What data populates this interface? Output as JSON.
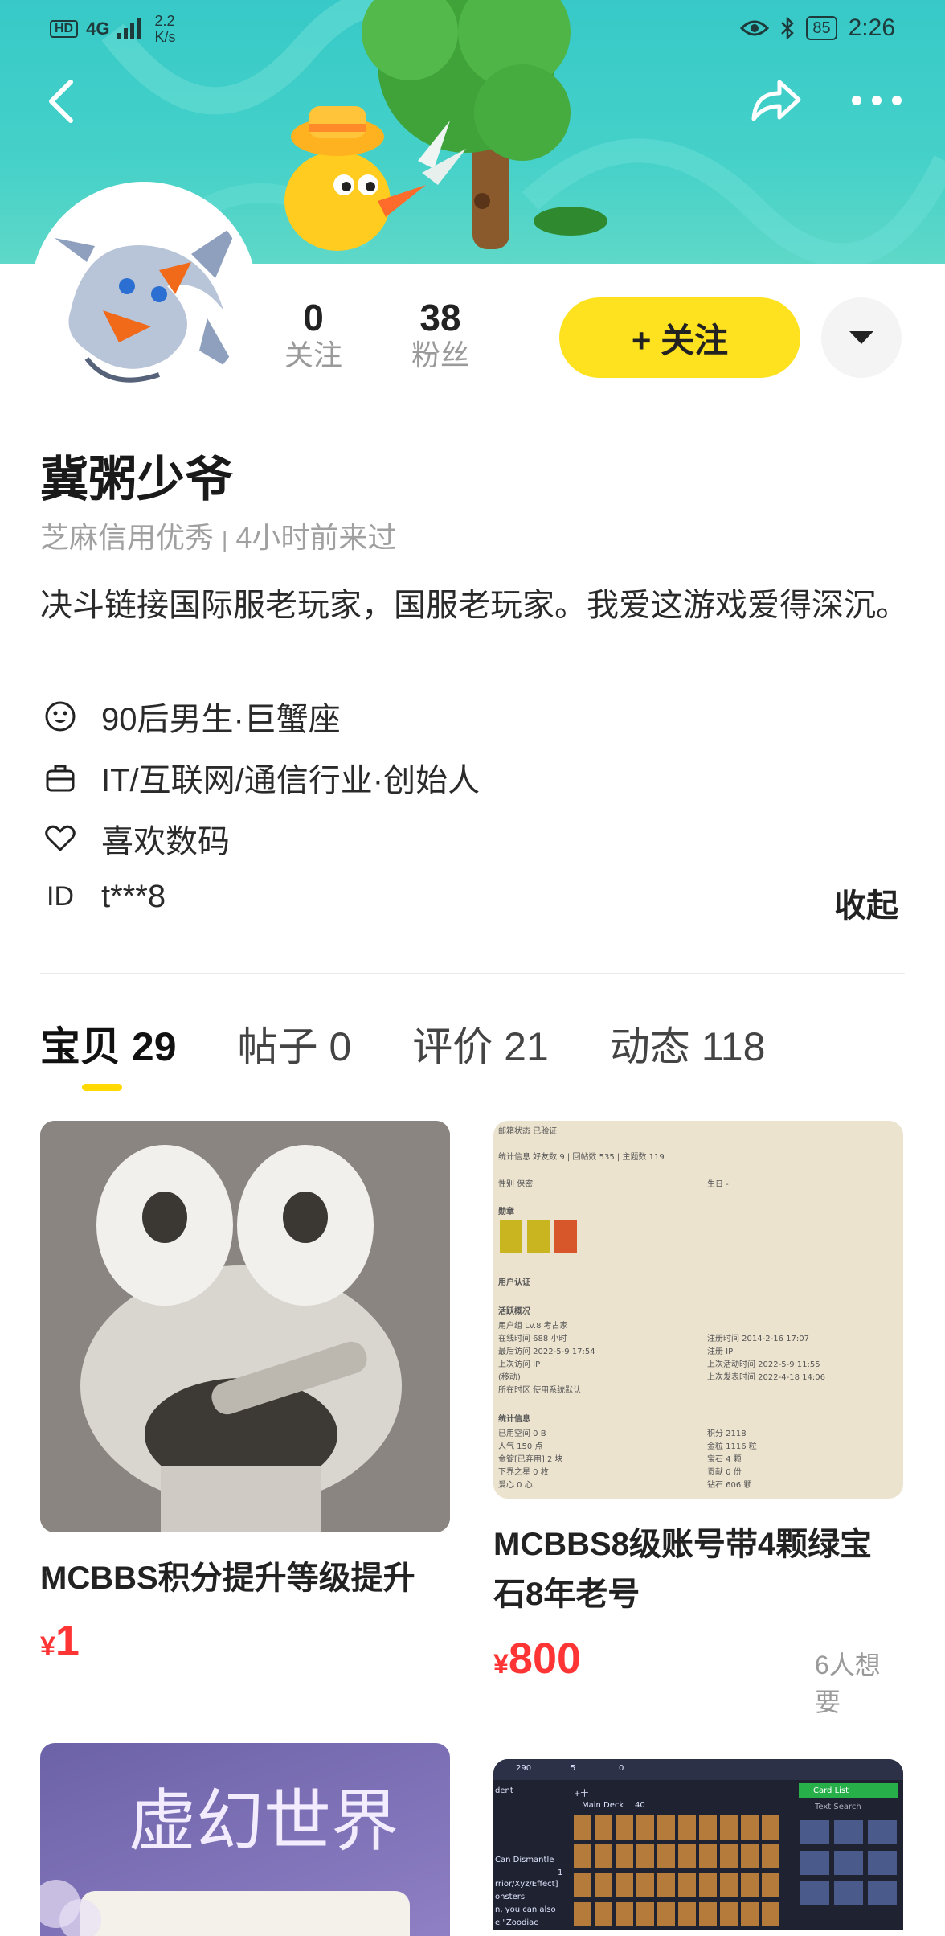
{
  "status_bar": {
    "left_badge": "HD",
    "network": "4G",
    "speed_value": "2.2",
    "speed_unit": "K/s",
    "battery": "85",
    "time": "2:26"
  },
  "profile": {
    "stats": [
      {
        "value": "0",
        "label": "关注"
      },
      {
        "value": "38",
        "label": "粉丝"
      }
    ],
    "follow_button": "+ 关注",
    "name": "冀粥少爷",
    "credit": "芝麻信用优秀",
    "last_seen": "4小时前来过",
    "bio": "决斗链接国际服老玩家，国服老玩家。我爱这游戏爱得深沉。",
    "info": [
      {
        "icon": "smiley-icon",
        "text": "90后男生·巨蟹座"
      },
      {
        "icon": "briefcase-icon",
        "text": "IT/互联网/通信行业·创始人"
      },
      {
        "icon": "heart-icon",
        "text": "喜欢数码"
      },
      {
        "icon": "id-label",
        "text": "t***8"
      }
    ],
    "id_label": "ID",
    "collapse": "收起"
  },
  "tabs": [
    {
      "label": "宝贝",
      "count": "29",
      "active": true
    },
    {
      "label": "帖子",
      "count": "0",
      "active": false
    },
    {
      "label": "评价",
      "count": "21",
      "active": false
    },
    {
      "label": "动态",
      "count": "118",
      "active": false
    }
  ],
  "products": [
    {
      "title": "MCBBS积分提升等级提升",
      "currency": "¥",
      "price": "1"
    },
    {
      "title": "MCBBS8级账号带4颗绿宝石8年老号",
      "currency": "¥",
      "price": "800",
      "wants": "6人想要"
    },
    {
      "image_text": "虚幻世界"
    },
    {
      "image_text": "Main Deck"
    }
  ],
  "screenshot_text": {
    "email_status": "邮箱状态 已验证",
    "stats_line": "统计信息 好友数 9 | 回帖数 535 | 主题数 119",
    "gender": "性别 保密",
    "birthday": "生日 -",
    "medals": "勋章",
    "user_auth": "用户认证",
    "activity": "活跃概况",
    "user_group": "用户组 Lv.8 考古家",
    "online": "在线时间 688 小时",
    "reg_time": "注册时间 2014-2-16 17:07",
    "last_visit": "最后访问 2022-5-9 17:54",
    "reg_ip": "注册 IP",
    "last_ip": "上次访问 IP",
    "last_active": "上次活动时间 2022-5-9 11:55",
    "move": "(移动)",
    "last_post": "上次发表时间 2022-4-18 14:06",
    "timezone": "所在时区 使用系统默认",
    "stats_info": "统计信息",
    "used_space": "已用空间 0 B",
    "points": "积分 2118",
    "popularity": "人气 150 点",
    "gold": "金粒 1116 粒",
    "gold_ingot": "金锭[已弃用] 2 块",
    "gem": "宝石 4 颗",
    "nether_star": "下界之星 0 枚",
    "contribution": "贡献 0 份",
    "love": "爱心 0 心",
    "diamond": "钻石 606 颗"
  },
  "deck_text": {
    "top_a": "290",
    "top_b": "5",
    "top_c": "0",
    "dent": "dent",
    "plus10": "+十",
    "main_deck": "Main Deck",
    "count": "40",
    "card_list": "Card List",
    "text_search": "Text Search",
    "can_dismantle": "Can Dismantle",
    "count_1": "1",
    "xyz": "rrior/Xyz/Effect]",
    "onsters": "onsters",
    "can_also": "n, you can also",
    "zoodiac": "e \"Zoodiac"
  }
}
